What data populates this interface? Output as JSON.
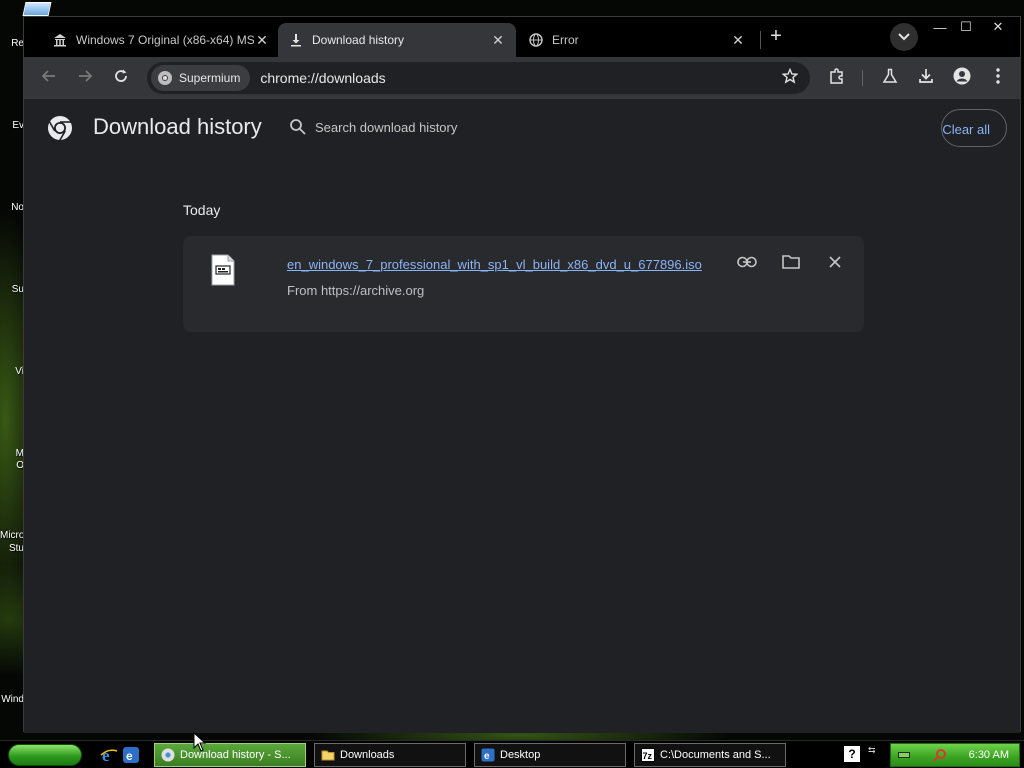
{
  "desktop": {
    "icon_labels": [
      "Re",
      "Ev",
      "No",
      "Su",
      "Vi",
      "M",
      "O",
      "Micro",
      "Stu",
      "Wind"
    ]
  },
  "browser": {
    "tabs": [
      {
        "title": "Windows 7 Original (x86-x64) MSD",
        "icon": "bank-icon",
        "active": false
      },
      {
        "title": "Download history",
        "icon": "download-icon",
        "active": true
      },
      {
        "title": "Error",
        "icon": "globe-icon",
        "active": false
      }
    ],
    "new_tab_label": "+",
    "window_controls": {
      "minimize": "—",
      "maximize": "☐",
      "close": "✕"
    },
    "toolbar": {
      "site_chip_label": "Supermium",
      "url": "chrome://downloads"
    }
  },
  "downloads_page": {
    "title": "Download history",
    "search_placeholder": "Search download history",
    "clear_all_label": "Clear all",
    "section_label": "Today",
    "items": [
      {
        "file_name": "en_windows_7_professional_with_sp1_vl_build_x86_dvd_u_677896.iso",
        "source": "From https://archive.org"
      }
    ]
  },
  "taskbar": {
    "buttons": [
      {
        "label": "Download history - S...",
        "icon": "chrome-icon",
        "active": true
      },
      {
        "label": "Downloads",
        "icon": "folder-icon",
        "active": false
      },
      {
        "label": "Desktop",
        "icon": "ie-icon",
        "active": false
      },
      {
        "label": "C:\\Documents and S...",
        "icon": "7zip-icon",
        "active": false
      }
    ],
    "help_label": "?",
    "clock": "6:30 AM"
  },
  "colors": {
    "page_bg": "#202124",
    "card_bg": "#292a2d",
    "link": "#8ab4f8",
    "toolbar_bg": "#35363a",
    "taskbar_green": "#3aa322"
  }
}
